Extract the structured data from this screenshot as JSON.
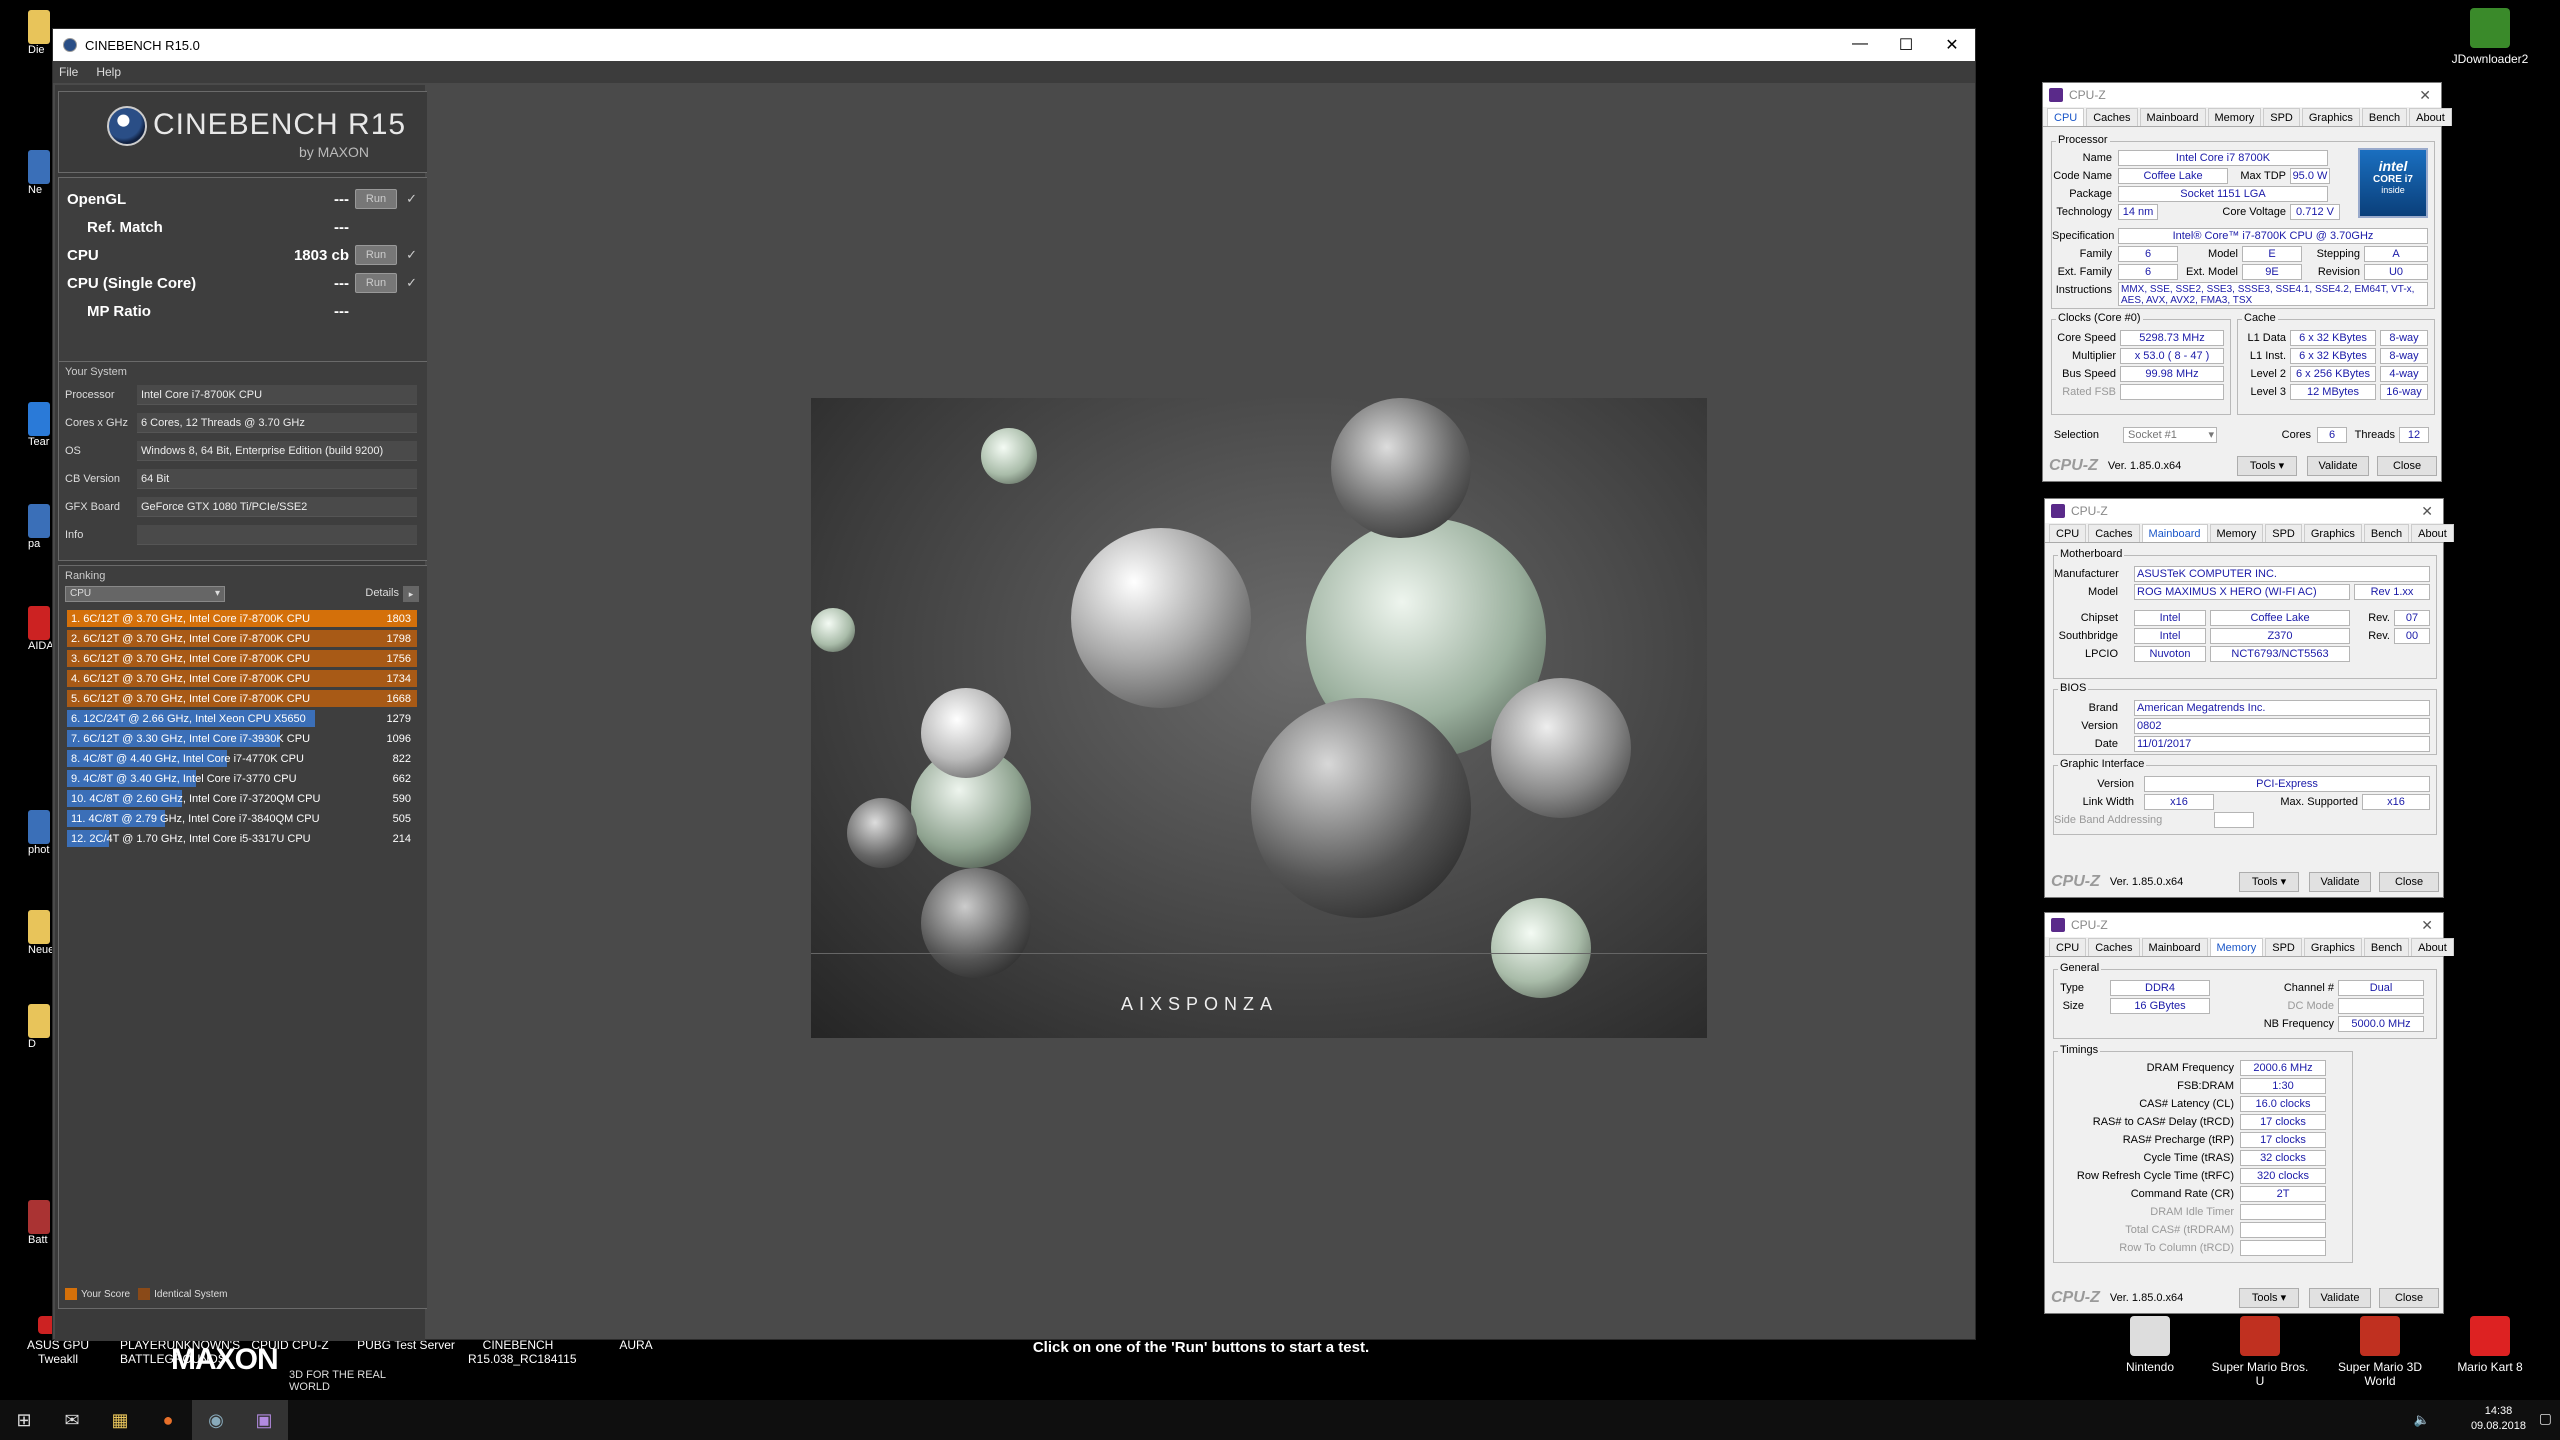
{
  "desktop": {
    "right_icons": [
      {
        "label": "JDownloader2"
      },
      {
        "label": "Nintendo"
      },
      {
        "label": "Super Mario Bros. U"
      },
      {
        "label": "Super Mario 3D World"
      },
      {
        "label": "Mario Kart 8"
      }
    ],
    "bottom_icons": [
      {
        "label": "ASUS GPU Tweakll"
      },
      {
        "label": "PLAYERUNKNOWN'S BATTLEGROUNDS"
      },
      {
        "label": "CPUID CPU-Z"
      },
      {
        "label": "PUBG Test Server"
      },
      {
        "label": "CINEBENCH R15.038_RC184115"
      },
      {
        "label": "AURA"
      }
    ],
    "left_stubs": [
      "Die",
      "Ne",
      "Tear",
      "pa",
      "AIDA6",
      "phot",
      "Neue",
      "D",
      "Batt"
    ]
  },
  "cinebench": {
    "title": "CINEBENCH R15.0",
    "menu": [
      "File",
      "Help"
    ],
    "logo_name": "CINEBENCH R15",
    "logo_by": "by MAXON",
    "tests": [
      {
        "label": "OpenGL",
        "value": "---",
        "run": "Run",
        "indent": false
      },
      {
        "label": "Ref. Match",
        "value": "---",
        "run": "",
        "indent": true
      },
      {
        "label": "CPU",
        "value": "1803 cb",
        "run": "Run",
        "indent": false
      },
      {
        "label": "CPU (Single Core)",
        "value": "---",
        "run": "Run",
        "indent": false
      },
      {
        "label": "MP Ratio",
        "value": "---",
        "run": "",
        "indent": true
      }
    ],
    "system_title": "Your System",
    "system": [
      {
        "label": "Processor",
        "value": "Intel Core i7-8700K CPU"
      },
      {
        "label": "Cores x GHz",
        "value": "6 Cores, 12 Threads @ 3.70 GHz"
      },
      {
        "label": "OS",
        "value": "Windows 8, 64 Bit, Enterprise Edition (build 9200)"
      },
      {
        "label": "CB Version",
        "value": "64 Bit"
      },
      {
        "label": "GFX Board",
        "value": "GeForce GTX 1080 Ti/PCIe/SSE2"
      },
      {
        "label": "Info",
        "value": ""
      }
    ],
    "ranking_title": "Ranking",
    "ranking_select": "CPU",
    "ranking_details": "Details",
    "ranking": [
      {
        "label": "1. 6C/12T @ 3.70 GHz, Intel Core i7-8700K CPU",
        "score": 1803,
        "kind": "own"
      },
      {
        "label": "2. 6C/12T @ 3.70 GHz, Intel Core i7-8700K CPU",
        "score": 1798,
        "kind": "identical"
      },
      {
        "label": "3. 6C/12T @ 3.70 GHz, Intel Core i7-8700K CPU",
        "score": 1756,
        "kind": "identical"
      },
      {
        "label": "4. 6C/12T @ 3.70 GHz, Intel Core i7-8700K CPU",
        "score": 1734,
        "kind": "identical"
      },
      {
        "label": "5. 6C/12T @ 3.70 GHz, Intel Core i7-8700K CPU",
        "score": 1668,
        "kind": "identical"
      },
      {
        "label": "6. 12C/24T @ 2.66 GHz, Intel Xeon CPU X5650",
        "score": 1279,
        "kind": "other"
      },
      {
        "label": "7. 6C/12T @ 3.30 GHz,  Intel Core i7-3930K CPU",
        "score": 1096,
        "kind": "other"
      },
      {
        "label": "8. 4C/8T @ 4.40 GHz, Intel Core i7-4770K CPU",
        "score": 822,
        "kind": "other"
      },
      {
        "label": "9. 4C/8T @ 3.40 GHz,  Intel Core i7-3770 CPU",
        "score": 662,
        "kind": "other"
      },
      {
        "label": "10. 4C/8T @ 2.60 GHz, Intel Core i7-3720QM CPU",
        "score": 590,
        "kind": "other"
      },
      {
        "label": "11. 4C/8T @ 2.79 GHz,  Intel Core i7-3840QM CPU",
        "score": 505,
        "kind": "other"
      },
      {
        "label": "12. 2C/4T @ 1.70 GHz,  Intel Core i5-3317U CPU",
        "score": 214,
        "kind": "other"
      }
    ],
    "ranking_max": 1803,
    "legend": [
      {
        "label": "Your Score",
        "color": "#d4700a"
      },
      {
        "label": "Identical System",
        "color": "#8a4a18"
      }
    ],
    "maxon": "MAXON",
    "maxon_sub": "3D FOR THE REAL WORLD",
    "render_brand": "AIXSPONZA",
    "status": "Click on one of the 'Run' buttons to start a test.",
    "colors": {
      "own": "#d4700a",
      "identical": "#a85a16",
      "other": "#3b6fb8"
    }
  },
  "cpuz_cpu": {
    "title": "CPU-Z",
    "tabs": [
      "CPU",
      "Caches",
      "Mainboard",
      "Memory",
      "SPD",
      "Graphics",
      "Bench",
      "About"
    ],
    "active": "CPU",
    "processor_group": "Processor",
    "name_label": "Name",
    "name": "Intel Core i7 8700K",
    "codename_label": "Code Name",
    "codename": "Coffee Lake",
    "tdp_label": "Max TDP",
    "tdp": "95.0 W",
    "package_label": "Package",
    "package": "Socket 1151 LGA",
    "tech_label": "Technology",
    "tech": "14 nm",
    "voltage_label": "Core Voltage",
    "voltage": "0.712 V",
    "spec_label": "Specification",
    "spec": "Intel® Core™ i7-8700K CPU @ 3.70GHz",
    "family_label": "Family",
    "family": "6",
    "model_label": "Model",
    "model": "E",
    "stepping_label": "Stepping",
    "stepping": "A",
    "extfamily_label": "Ext. Family",
    "extfamily": "6",
    "extmodel_label": "Ext. Model",
    "extmodel": "9E",
    "revision_label": "Revision",
    "revision": "U0",
    "instr_label": "Instructions",
    "instr": "MMX, SSE, SSE2, SSE3, SSSE3, SSE4.1, SSE4.2, EM64T, VT-x, AES, AVX, AVX2, FMA3, TSX",
    "clocks_group": "Clocks (Core #0)",
    "corespeed_label": "Core Speed",
    "corespeed": "5298.73 MHz",
    "multiplier_label": "Multiplier",
    "multiplier": "x 53.0 ( 8 - 47 )",
    "busspeed_label": "Bus Speed",
    "busspeed": "99.98 MHz",
    "ratedfsb_label": "Rated FSB",
    "ratedfsb": "",
    "cache_group": "Cache",
    "l1d_label": "L1 Data",
    "l1d": "6 x 32 KBytes",
    "l1d_way": "8-way",
    "l1i_label": "L1 Inst.",
    "l1i": "6 x 32 KBytes",
    "l1i_way": "8-way",
    "l2_label": "Level 2",
    "l2": "6 x 256 KBytes",
    "l2_way": "4-way",
    "l3_label": "Level 3",
    "l3": "12 MBytes",
    "l3_way": "16-way",
    "selection_label": "Selection",
    "selection": "Socket #1",
    "cores_label": "Cores",
    "cores": "6",
    "threads_label": "Threads",
    "threads": "12",
    "badge_brand": "intel",
    "badge_line1": "CORE i7",
    "badge_line2": "inside",
    "brand": "CPU-Z",
    "ver": "Ver. 1.85.0.x64",
    "tools": "Tools",
    "validate": "Validate",
    "close": "Close"
  },
  "cpuz_mb": {
    "title": "CPU-Z",
    "tabs": [
      "CPU",
      "Caches",
      "Mainboard",
      "Memory",
      "SPD",
      "Graphics",
      "Bench",
      "About"
    ],
    "active": "Mainboard",
    "mb_group": "Motherboard",
    "manufacturer_label": "Manufacturer",
    "manufacturer": "ASUSTeK COMPUTER INC.",
    "model_label": "Model",
    "model": "ROG MAXIMUS X HERO (WI-FI AC)",
    "model_rev": "Rev 1.xx",
    "chipset_label": "Chipset",
    "chipset": "Intel",
    "chipset_name": "Coffee Lake",
    "chipset_rev_label": "Rev.",
    "chipset_rev": "07",
    "south_label": "Southbridge",
    "south": "Intel",
    "south_name": "Z370",
    "south_rev_label": "Rev.",
    "south_rev": "00",
    "lpcio_label": "LPCIO",
    "lpcio": "Nuvoton",
    "lpcio_name": "NCT6793/NCT5563",
    "bios_group": "BIOS",
    "brand_label": "Brand",
    "bios_brand": "American Megatrends Inc.",
    "version_label": "Version",
    "bios_version": "0802",
    "date_label": "Date",
    "bios_date": "11/01/2017",
    "gi_group": "Graphic Interface",
    "gi_version_label": "Version",
    "gi_version": "PCI-Express",
    "linkwidth_label": "Link Width",
    "linkwidth": "x16",
    "maxsup_label": "Max. Supported",
    "maxsup": "x16",
    "sideband_label": "Side Band Addressing",
    "brand": "CPU-Z",
    "ver": "Ver. 1.85.0.x64",
    "tools": "Tools",
    "validate": "Validate",
    "close": "Close"
  },
  "cpuz_mem": {
    "title": "CPU-Z",
    "tabs": [
      "CPU",
      "Caches",
      "Mainboard",
      "Memory",
      "SPD",
      "Graphics",
      "Bench",
      "About"
    ],
    "active": "Memory",
    "general_group": "General",
    "type_label": "Type",
    "type": "DDR4",
    "channel_label": "Channel #",
    "channel": "Dual",
    "dcmode_label": "DC Mode",
    "size_label": "Size",
    "size": "16 GBytes",
    "nbfreq_label": "NB Frequency",
    "nbfreq": "5000.0 MHz",
    "timings_group": "Timings",
    "timings": [
      {
        "label": "DRAM Frequency",
        "value": "2000.6 MHz",
        "dis": false
      },
      {
        "label": "FSB:DRAM",
        "value": "1:30",
        "dis": false
      },
      {
        "label": "CAS# Latency (CL)",
        "value": "16.0 clocks",
        "dis": false
      },
      {
        "label": "RAS# to CAS# Delay (tRCD)",
        "value": "17 clocks",
        "dis": false
      },
      {
        "label": "RAS# Precharge (tRP)",
        "value": "17 clocks",
        "dis": false
      },
      {
        "label": "Cycle Time (tRAS)",
        "value": "32 clocks",
        "dis": false
      },
      {
        "label": "Row Refresh Cycle Time (tRFC)",
        "value": "320 clocks",
        "dis": false
      },
      {
        "label": "Command Rate (CR)",
        "value": "2T",
        "dis": false
      },
      {
        "label": "DRAM Idle Timer",
        "value": "",
        "dis": true
      },
      {
        "label": "Total CAS# (tRDRAM)",
        "value": "",
        "dis": true
      },
      {
        "label": "Row To Column (tRCD)",
        "value": "",
        "dis": true
      }
    ],
    "brand": "CPU-Z",
    "ver": "Ver. 1.85.0.x64",
    "tools": "Tools",
    "validate": "Validate",
    "close": "Close"
  },
  "taskbar": {
    "time": "14:38",
    "date": "09.08.2018"
  }
}
